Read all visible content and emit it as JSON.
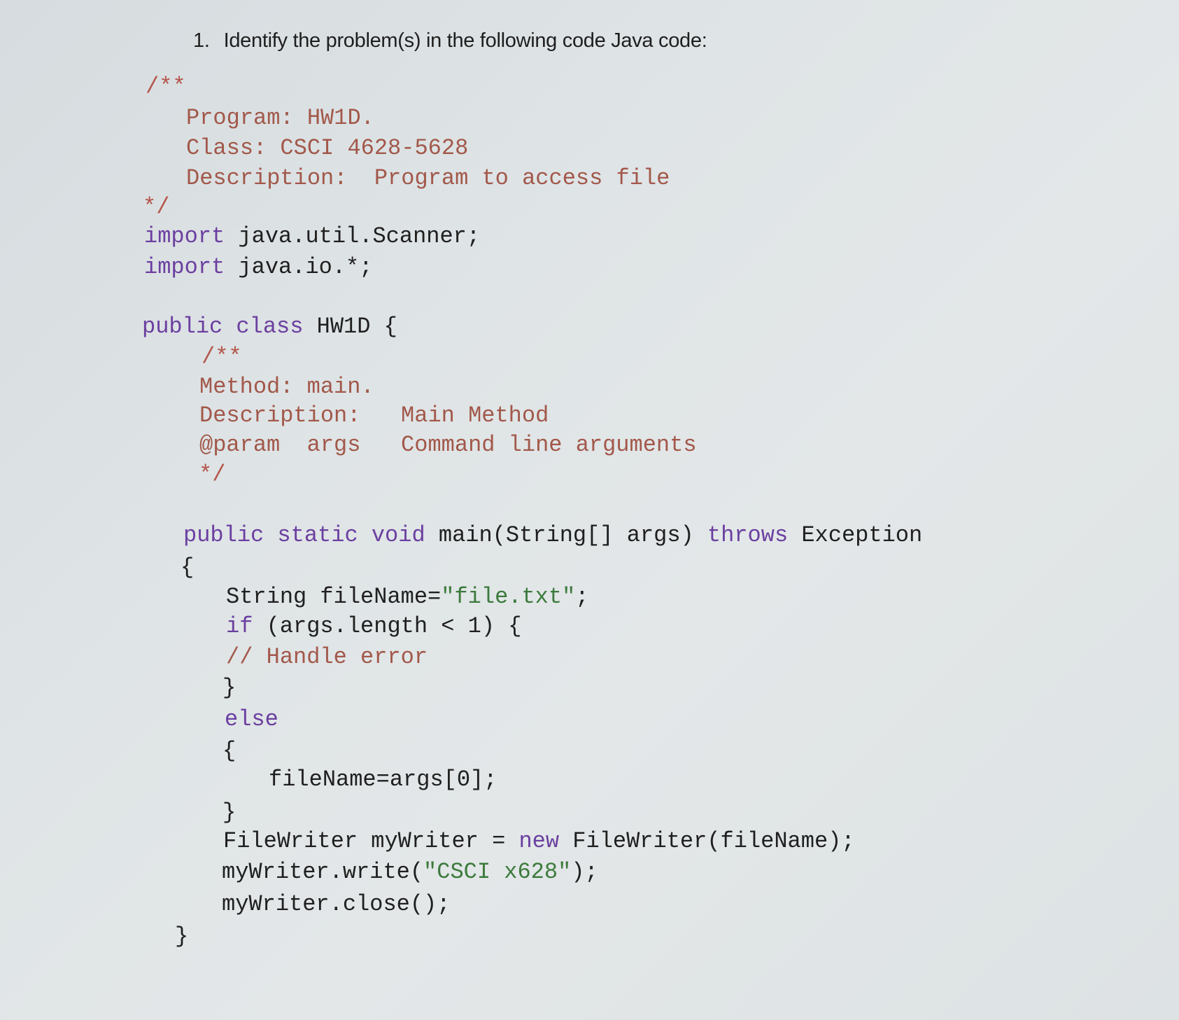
{
  "question": {
    "number": "1.",
    "text": "Identify the problem(s) in the following code Java code:"
  },
  "code": {
    "header_comment": {
      "open": "/**",
      "program": "Program: HW1D.",
      "class": "Class: CSCI 4628-5628",
      "description_label": "Description:",
      "description_value": "Program to access file",
      "close": "*/"
    },
    "imports": [
      {
        "keyword": "import",
        "path": "java.util.Scanner;"
      },
      {
        "keyword": "import",
        "path": "java.io.*;"
      }
    ],
    "class_decl": {
      "kw1": "public",
      "kw2": "class",
      "name": "HW1D {"
    },
    "method_comment": {
      "open": "/**",
      "method": "Method: main.",
      "description_label": "Description:",
      "description_value": "Main Method",
      "param_label": "@param",
      "param_name": "args",
      "param_value": "Command line arguments",
      "close": "*/"
    },
    "method_decl": {
      "kw1": "public",
      "kw2": "static",
      "kw3": "void",
      "signature": "main(String[] args)",
      "kw4": "throws",
      "exception": "Exception"
    },
    "open_brace": "{",
    "stmt_filename_prefix": "String fileName=",
    "stmt_filename_string": "\"file.txt\"",
    "stmt_filename_suffix": ";",
    "if_kw": "if",
    "if_cond": "(args.length < 1) {",
    "handle_comment": "// Handle error",
    "close_brace": "}",
    "else_kw": "else",
    "else_open": "{",
    "assign_stmt": "fileName=args[0];",
    "else_close": "}",
    "writer_prefix": "FileWriter myWriter = ",
    "writer_new": "new",
    "writer_suffix": " FileWriter(fileName);",
    "write_prefix": "myWriter.write(",
    "write_string": "\"CSCI x628\"",
    "write_suffix": ");",
    "close_stmt": "myWriter.close();",
    "method_close": "}"
  }
}
